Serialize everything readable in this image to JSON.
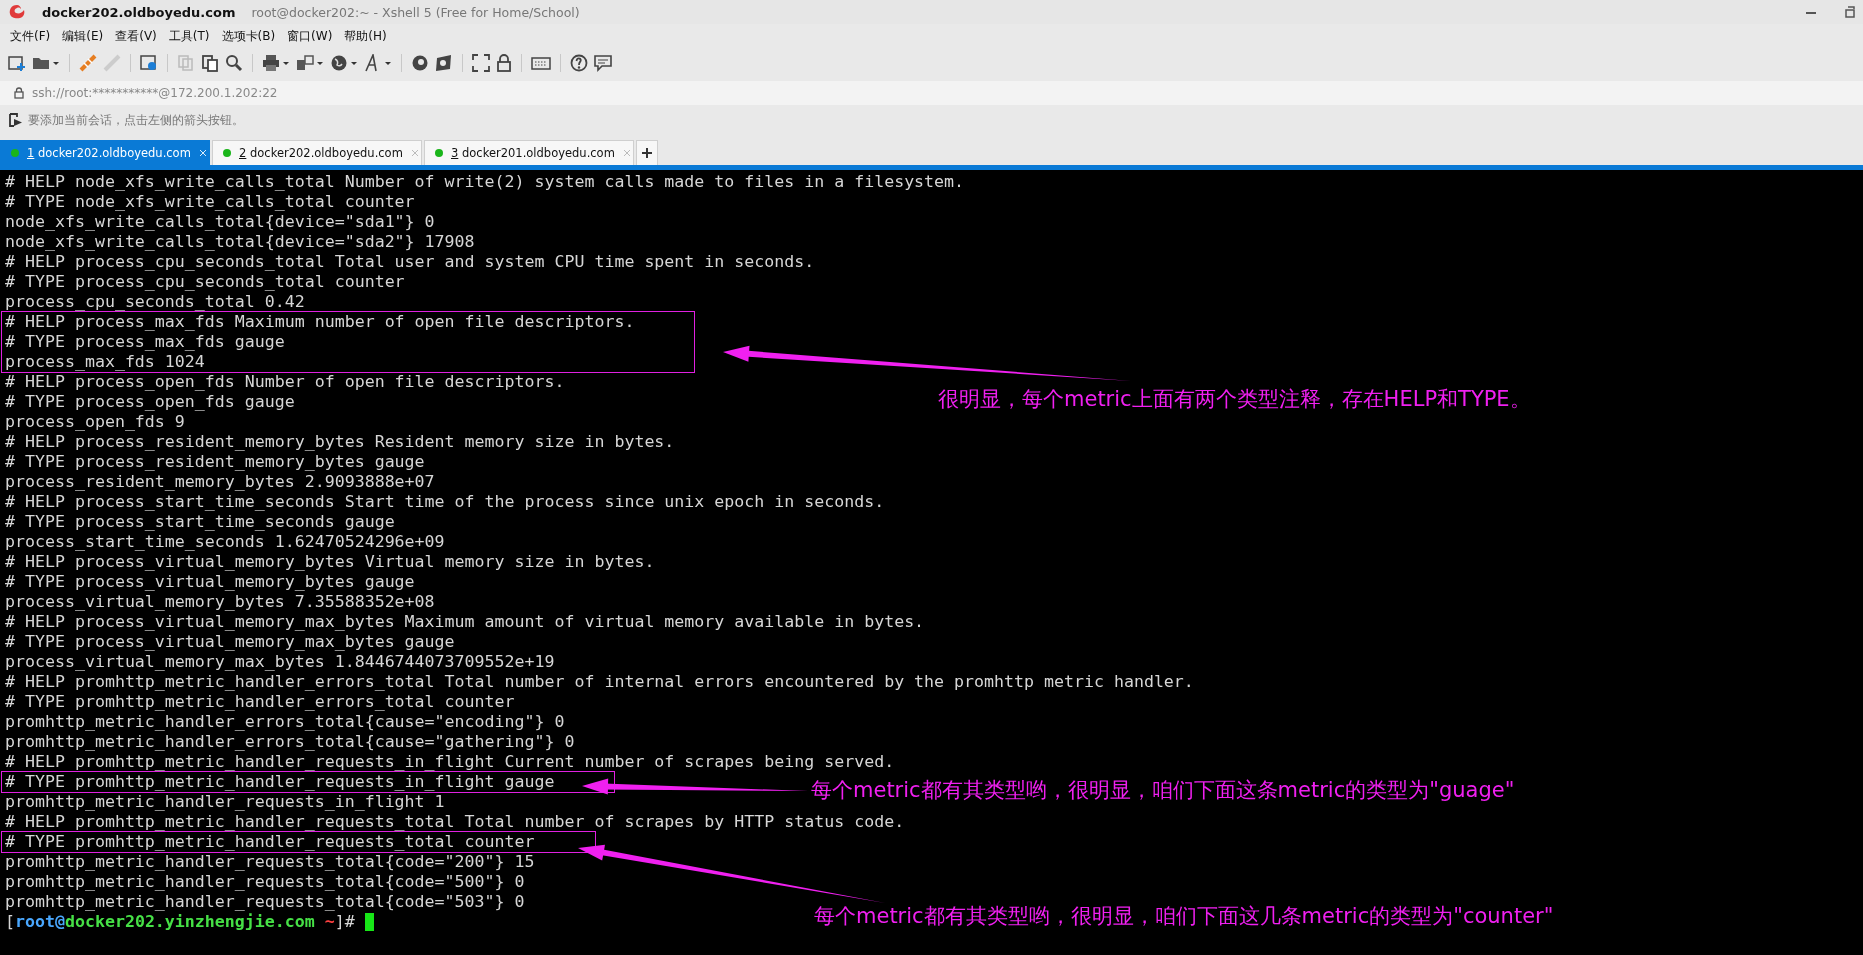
{
  "window": {
    "title": "docker202.oldboyedu.com",
    "subtitle": "root@docker202:~ - Xshell 5 (Free for Home/School)"
  },
  "menu": [
    "文件(F)",
    "编辑(E)",
    "查看(V)",
    "工具(T)",
    "选项卡(B)",
    "窗口(W)",
    "帮助(H)"
  ],
  "address": "ssh://root:***********@172.200.1.202:22",
  "hint": "要添加当前会话，点击左侧的箭头按钮。",
  "tabs": [
    {
      "number": "1",
      "label": "docker202.oldboyedu.com",
      "selected": true
    },
    {
      "number": "2",
      "label": "docker202.oldboyedu.com",
      "selected": false
    },
    {
      "number": "3",
      "label": "docker201.oldboyedu.com",
      "selected": false
    }
  ],
  "terminal": {
    "lines": [
      {
        "text": "# HELP node_xfs_write_calls_total Number of write(2) system calls made to files in a filesystem.",
        "boxed": false
      },
      {
        "text": "# TYPE node_xfs_write_calls_total counter",
        "boxed": false
      },
      {
        "text": "node_xfs_write_calls_total{device=\"sda1\"} 0",
        "boxed": false
      },
      {
        "text": "node_xfs_write_calls_total{device=\"sda2\"} 17908",
        "boxed": false
      },
      {
        "text": "# HELP process_cpu_seconds_total Total user and system CPU time spent in seconds.",
        "boxed": false
      },
      {
        "text": "# TYPE process_cpu_seconds_total counter",
        "boxed": false
      },
      {
        "text": "process_cpu_seconds_total 0.42",
        "boxed": false
      },
      {
        "text": "# HELP process_max_fds Maximum number of open file descriptors.",
        "boxed": true
      },
      {
        "text": "# TYPE process_max_fds gauge",
        "boxed": true
      },
      {
        "text": "process_max_fds 1024",
        "boxed": true
      },
      {
        "text": "# HELP process_open_fds Number of open file descriptors.",
        "boxed": false
      },
      {
        "text": "# TYPE process_open_fds gauge",
        "boxed": false
      },
      {
        "text": "process_open_fds 9",
        "boxed": false
      },
      {
        "text": "# HELP process_resident_memory_bytes Resident memory size in bytes.",
        "boxed": false
      },
      {
        "text": "# TYPE process_resident_memory_bytes gauge",
        "boxed": false
      },
      {
        "text": "process_resident_memory_bytes 2.9093888e+07",
        "boxed": false
      },
      {
        "text": "# HELP process_start_time_seconds Start time of the process since unix epoch in seconds.",
        "boxed": false
      },
      {
        "text": "# TYPE process_start_time_seconds gauge",
        "boxed": false
      },
      {
        "text": "process_start_time_seconds 1.62470524296e+09",
        "boxed": false
      },
      {
        "text": "# HELP process_virtual_memory_bytes Virtual memory size in bytes.",
        "boxed": false
      },
      {
        "text": "# TYPE process_virtual_memory_bytes gauge",
        "boxed": false
      },
      {
        "text": "process_virtual_memory_bytes 7.35588352e+08",
        "boxed": false
      },
      {
        "text": "# HELP process_virtual_memory_max_bytes Maximum amount of virtual memory available in bytes.",
        "boxed": false
      },
      {
        "text": "# TYPE process_virtual_memory_max_bytes gauge",
        "boxed": false
      },
      {
        "text": "process_virtual_memory_max_bytes 1.8446744073709552e+19",
        "boxed": false
      },
      {
        "text": "# HELP promhttp_metric_handler_errors_total Total number of internal errors encountered by the promhttp metric handler.",
        "boxed": false
      },
      {
        "text": "# TYPE promhttp_metric_handler_errors_total counter",
        "boxed": false
      },
      {
        "text": "promhttp_metric_handler_errors_total{cause=\"encoding\"} 0",
        "boxed": false
      },
      {
        "text": "promhttp_metric_handler_errors_total{cause=\"gathering\"} 0",
        "boxed": false
      },
      {
        "text": "# HELP promhttp_metric_handler_requests_in_flight Current number of scrapes being served.",
        "boxed": false
      },
      {
        "text": "# TYPE promhttp_metric_handler_requests_in_flight gauge",
        "boxed": true
      },
      {
        "text": "promhttp_metric_handler_requests_in_flight 1",
        "boxed": false
      },
      {
        "text": "# HELP promhttp_metric_handler_requests_total Total number of scrapes by HTTP status code.",
        "boxed": false
      },
      {
        "text": "# TYPE promhttp_metric_handler_requests_total counter",
        "boxed": true
      },
      {
        "text": "promhttp_metric_handler_requests_total{code=\"200\"} 15",
        "boxed": false
      },
      {
        "text": "promhttp_metric_handler_requests_total{code=\"500\"} 0",
        "boxed": false
      },
      {
        "text": "promhttp_metric_handler_requests_total{code=\"503\"} 0",
        "boxed": false
      }
    ],
    "prompt": {
      "open": "[",
      "user": "root@",
      "host": "docker202.yinzhengjie.com",
      "path": " ~",
      "close": "]# "
    }
  },
  "annotations": [
    "很明显，每个metric上面有两个类型注释，存在HELP和TYPE。",
    "每个metric都有其类型哟，很明显，咱们下面这条metric的类型为\"guage\"",
    "每个metric都有其类型哟，很明显，咱们下面这几条metric的类型为\"counter\""
  ]
}
